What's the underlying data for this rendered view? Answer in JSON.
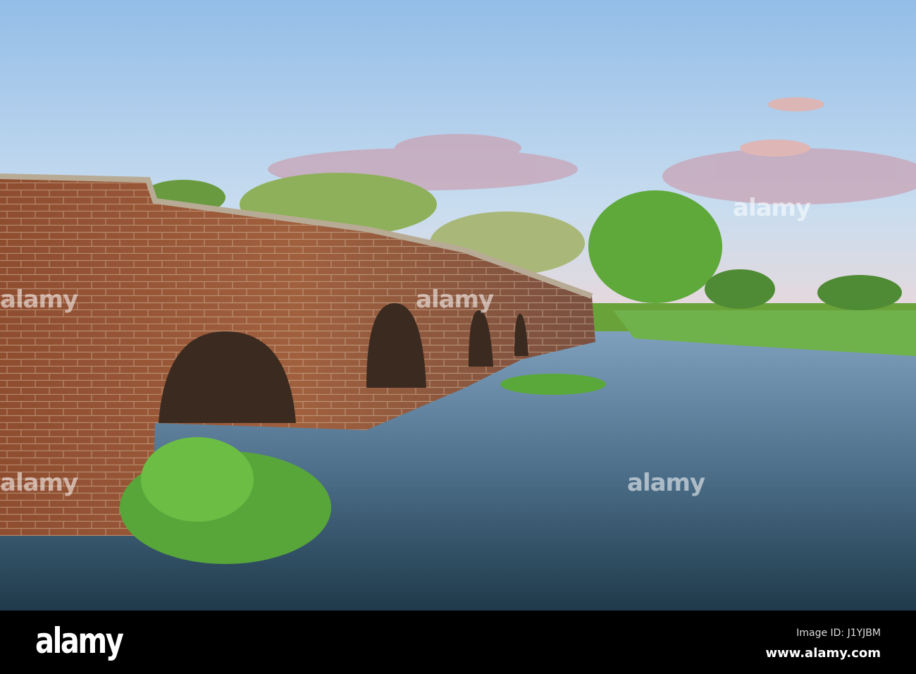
{
  "photo": {
    "subject": "brick-arch-bridge-over-river",
    "watermark_text": "alamy",
    "colors": {
      "sky_top": "#9ec4ea",
      "sky_bottom": "#f0d2d2",
      "brick": "#9a5a3a",
      "water": "#4f6f86",
      "grass": "#5fae3a"
    }
  },
  "footer": {
    "logo": "alamy",
    "image_id": "Image ID: J1YJBM",
    "url": "www.alamy.com"
  }
}
